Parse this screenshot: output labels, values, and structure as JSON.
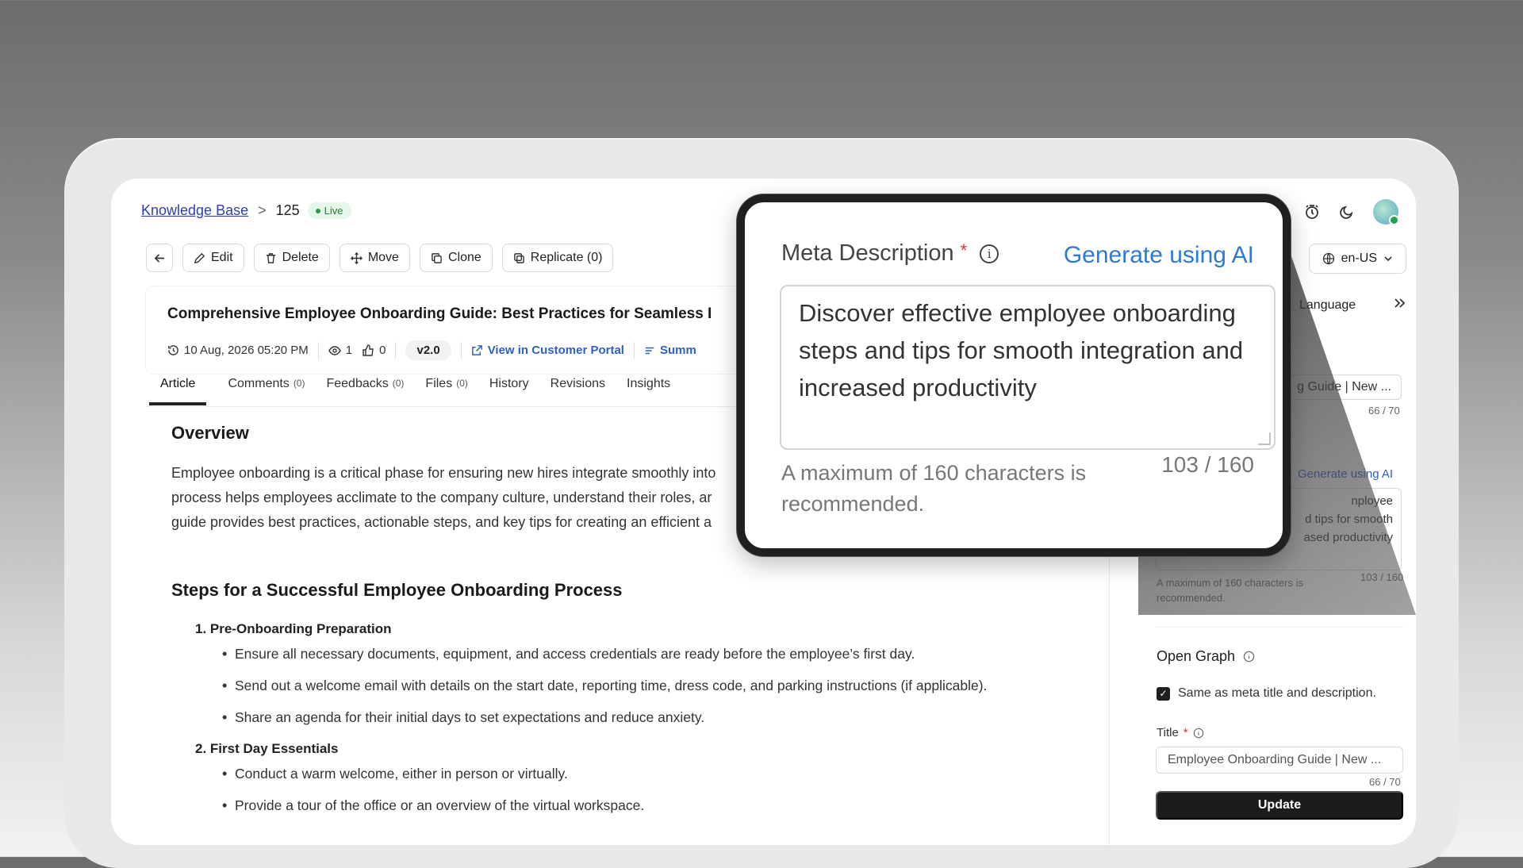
{
  "breadcrumb": {
    "root": "Knowledge Base",
    "separator": ">",
    "id": "125",
    "status": "Live"
  },
  "toolbar": {
    "edit": "Edit",
    "delete": "Delete",
    "move": "Move",
    "clone": "Clone",
    "replicate": "Replicate (0)"
  },
  "language_select": {
    "value": "en-US"
  },
  "article": {
    "title": "Comprehensive Employee Onboarding Guide: Best Practices for Seamless I",
    "date": "10 Aug, 2026 05:20 PM",
    "views": "1",
    "likes": "0",
    "version": "v2.0",
    "portal_link": "View in Customer Portal",
    "summary_link": "Summ"
  },
  "tabs": [
    {
      "label": "Article",
      "count": ""
    },
    {
      "label": "Comments",
      "count": "(0)"
    },
    {
      "label": "Feedbacks",
      "count": "(0)"
    },
    {
      "label": "Files",
      "count": "(0)"
    },
    {
      "label": "History",
      "count": ""
    },
    {
      "label": "Revisions",
      "count": ""
    },
    {
      "label": "Insights",
      "count": ""
    }
  ],
  "content": {
    "overview_heading": "Overview",
    "overview_lines": [
      "Employee onboarding is a critical phase for ensuring new hires integrate smoothly into",
      "process helps employees acclimate to the company culture, understand their roles, ar",
      "guide provides best practices, actionable steps, and key tips for creating an efficient a"
    ],
    "steps_heading": "Steps for a Successful Employee Onboarding Process",
    "step1": "1. Pre-Onboarding Preparation",
    "step1_bullets": [
      "Ensure all necessary documents, equipment, and access credentials are ready before the employee’s first day.",
      "Send out a welcome email with details on the start date, reporting time, dress code, and parking instructions (if applicable).",
      "Share an agenda for their initial days to set expectations and reduce anxiety."
    ],
    "step2": "2. First Day Essentials",
    "step2_bullets": [
      "Conduct a warm welcome, either in person or virtually.",
      "Provide a tour of the office or an overview of the virtual workspace."
    ]
  },
  "right_panel": {
    "language_label": "Language",
    "title_value": "g Guide | New ...",
    "title_count": "66 / 70",
    "title_hint_fragment": "rs is",
    "generate_ai": "Generate using AI",
    "description_lines": [
      "nployee",
      "d tips for smooth",
      "ased productivity"
    ],
    "description_hint": "A maximum of 160 characters is recommended.",
    "description_count": "103 / 160",
    "open_graph": {
      "heading": "Open Graph",
      "same_as_meta": "Same as meta title and description.",
      "title_label": "Title",
      "required_mark": "*",
      "title_value": "Employee Onboarding Guide | New ...",
      "title_count": "66 / 70"
    },
    "update_button": "Update"
  },
  "zoom_callout": {
    "label": "Meta Description",
    "required_mark": "*",
    "generate_ai": "Generate using AI",
    "textarea_value": "Discover effective employee onboarding steps and tips for smooth integration and increased productivity",
    "hint": "A maximum of 160 characters is recommended.",
    "count": "103 / 160"
  },
  "colors": {
    "link_blue": "#2d5fc4",
    "ai_blue": "#2d7ad6",
    "live_green": "#2b9a45",
    "required_red": "#d93030",
    "button_dark": "#1c1c1c"
  }
}
